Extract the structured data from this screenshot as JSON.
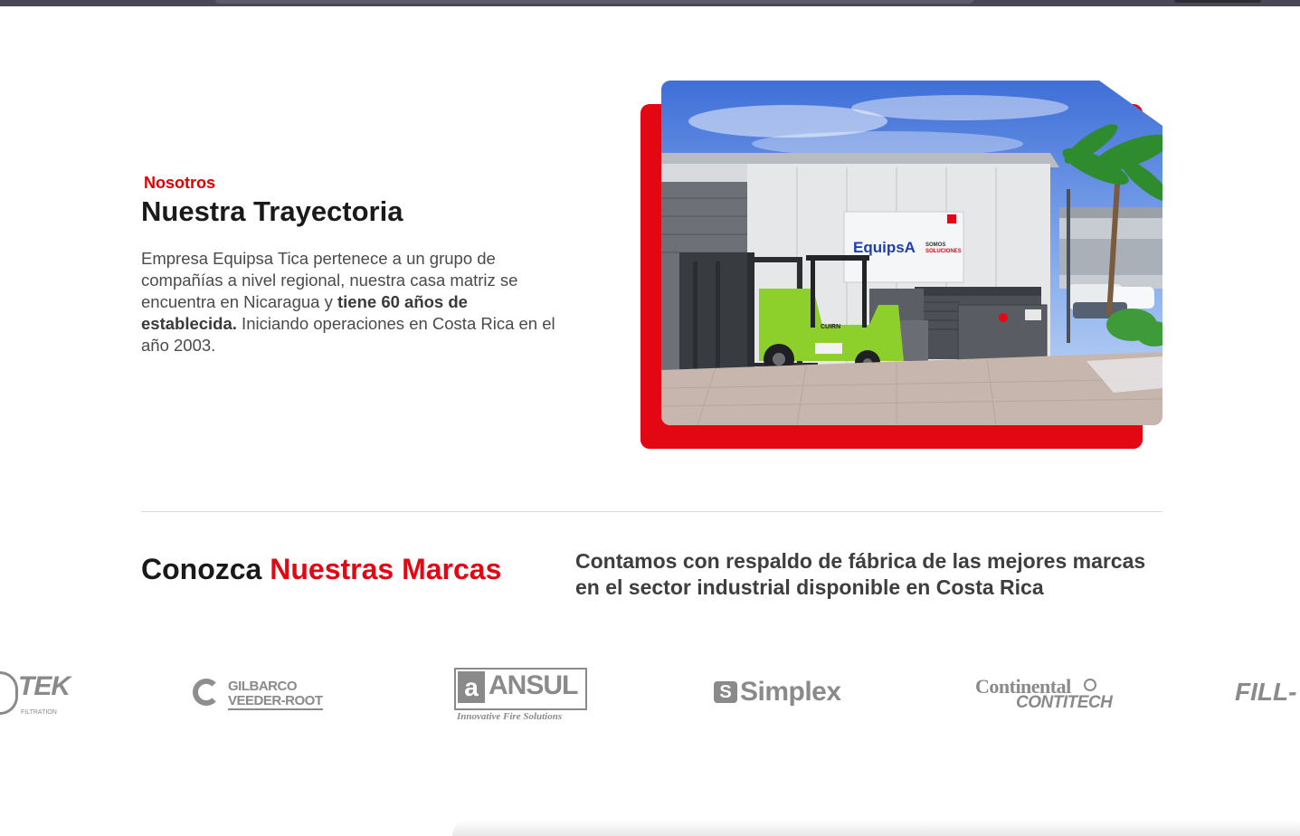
{
  "about": {
    "eyebrow": "Nosotros",
    "title": "Nuestra Trayectoria",
    "text_part1": "Empresa Equipsa Tica pertenece a un grupo de compañías a nivel regional, nuestra casa matriz se encuentra en Nicaragua y ",
    "text_bold": "tiene 60 años de establecida.",
    "text_part2": " Iniciando operaciones en Costa Rica en el año 2003.",
    "photo": {
      "sign_brand": "EquipsA",
      "sign_tagline_1": "SOMOS",
      "sign_tagline_2": "SOLUCIONES",
      "forklift_brand": "CUIRN"
    }
  },
  "brands": {
    "title_plain": "Conozca ",
    "title_accent": "Nuestras Marcas",
    "description": "Contamos con respaldo de fábrica de las mejores marcas en el sector industrial disponible en Costa Rica",
    "logos": [
      {
        "name": "TEK",
        "subtitle": "FILTRATION"
      },
      {
        "line1": "GILBARCO",
        "line2": "VEEDER-ROOT"
      },
      {
        "name": "ANSUL",
        "mark": "a",
        "tagline": "Innovative Fire Solutions"
      },
      {
        "name": "Simplex",
        "mark": "S"
      },
      {
        "line1": "Continental",
        "line2": "CONTITECH"
      },
      {
        "name": "FILL-"
      }
    ]
  },
  "colors": {
    "accent": "#e30613",
    "heading": "#1a1a1a",
    "body_text": "#4a4a4a",
    "logo_gray": "#8a8a8a"
  }
}
